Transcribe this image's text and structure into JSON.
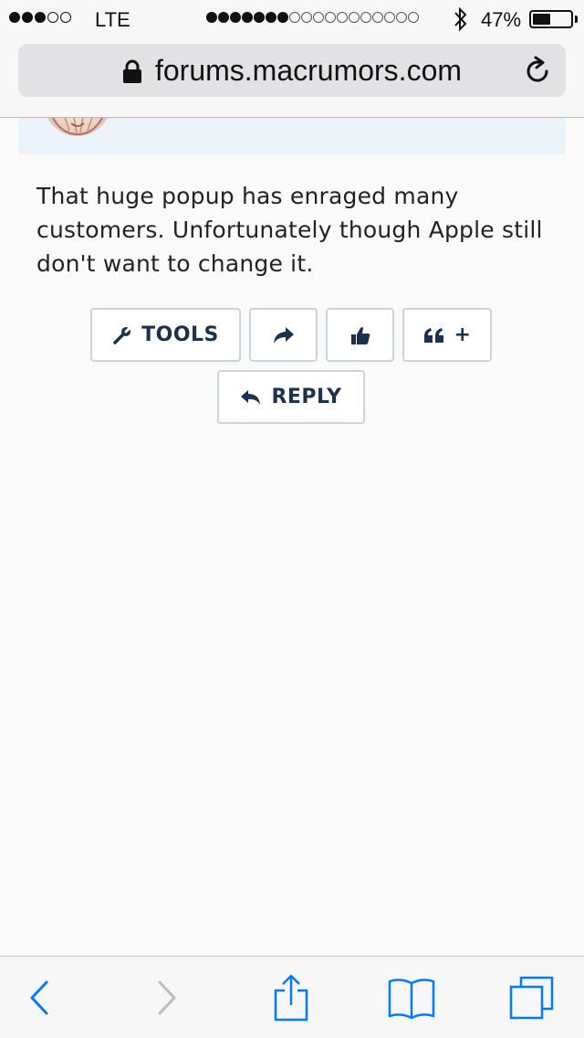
{
  "status_bar": {
    "signal_filled": 3,
    "signal_total": 5,
    "carrier": "LTE",
    "page_load_filled": 7,
    "page_load_total": 18,
    "battery_text": "47%",
    "battery_level": 0.47
  },
  "address_bar": {
    "url": "forums.macrumors.com"
  },
  "post": {
    "body": "That huge popup has enraged many customers. Unfortunately though Apple still don't want to change it."
  },
  "actions": {
    "tools_label": "TOOLS",
    "quote_plus": "+",
    "reply_label": "REPLY"
  },
  "colors": {
    "ios_blue": "#007aff",
    "button_text": "#1c3150",
    "button_border": "#cdd3db",
    "post_header_bg": "#ecf2fa"
  },
  "icons": {
    "tools": "wrench-icon",
    "share": "share-arrow-icon",
    "like": "thumbs-up-icon",
    "quote": "quote-icon",
    "reply": "reply-arrow-icon",
    "toolbar": [
      "back-icon",
      "forward-icon",
      "share-icon",
      "bookmarks-icon",
      "tabs-icon"
    ]
  }
}
